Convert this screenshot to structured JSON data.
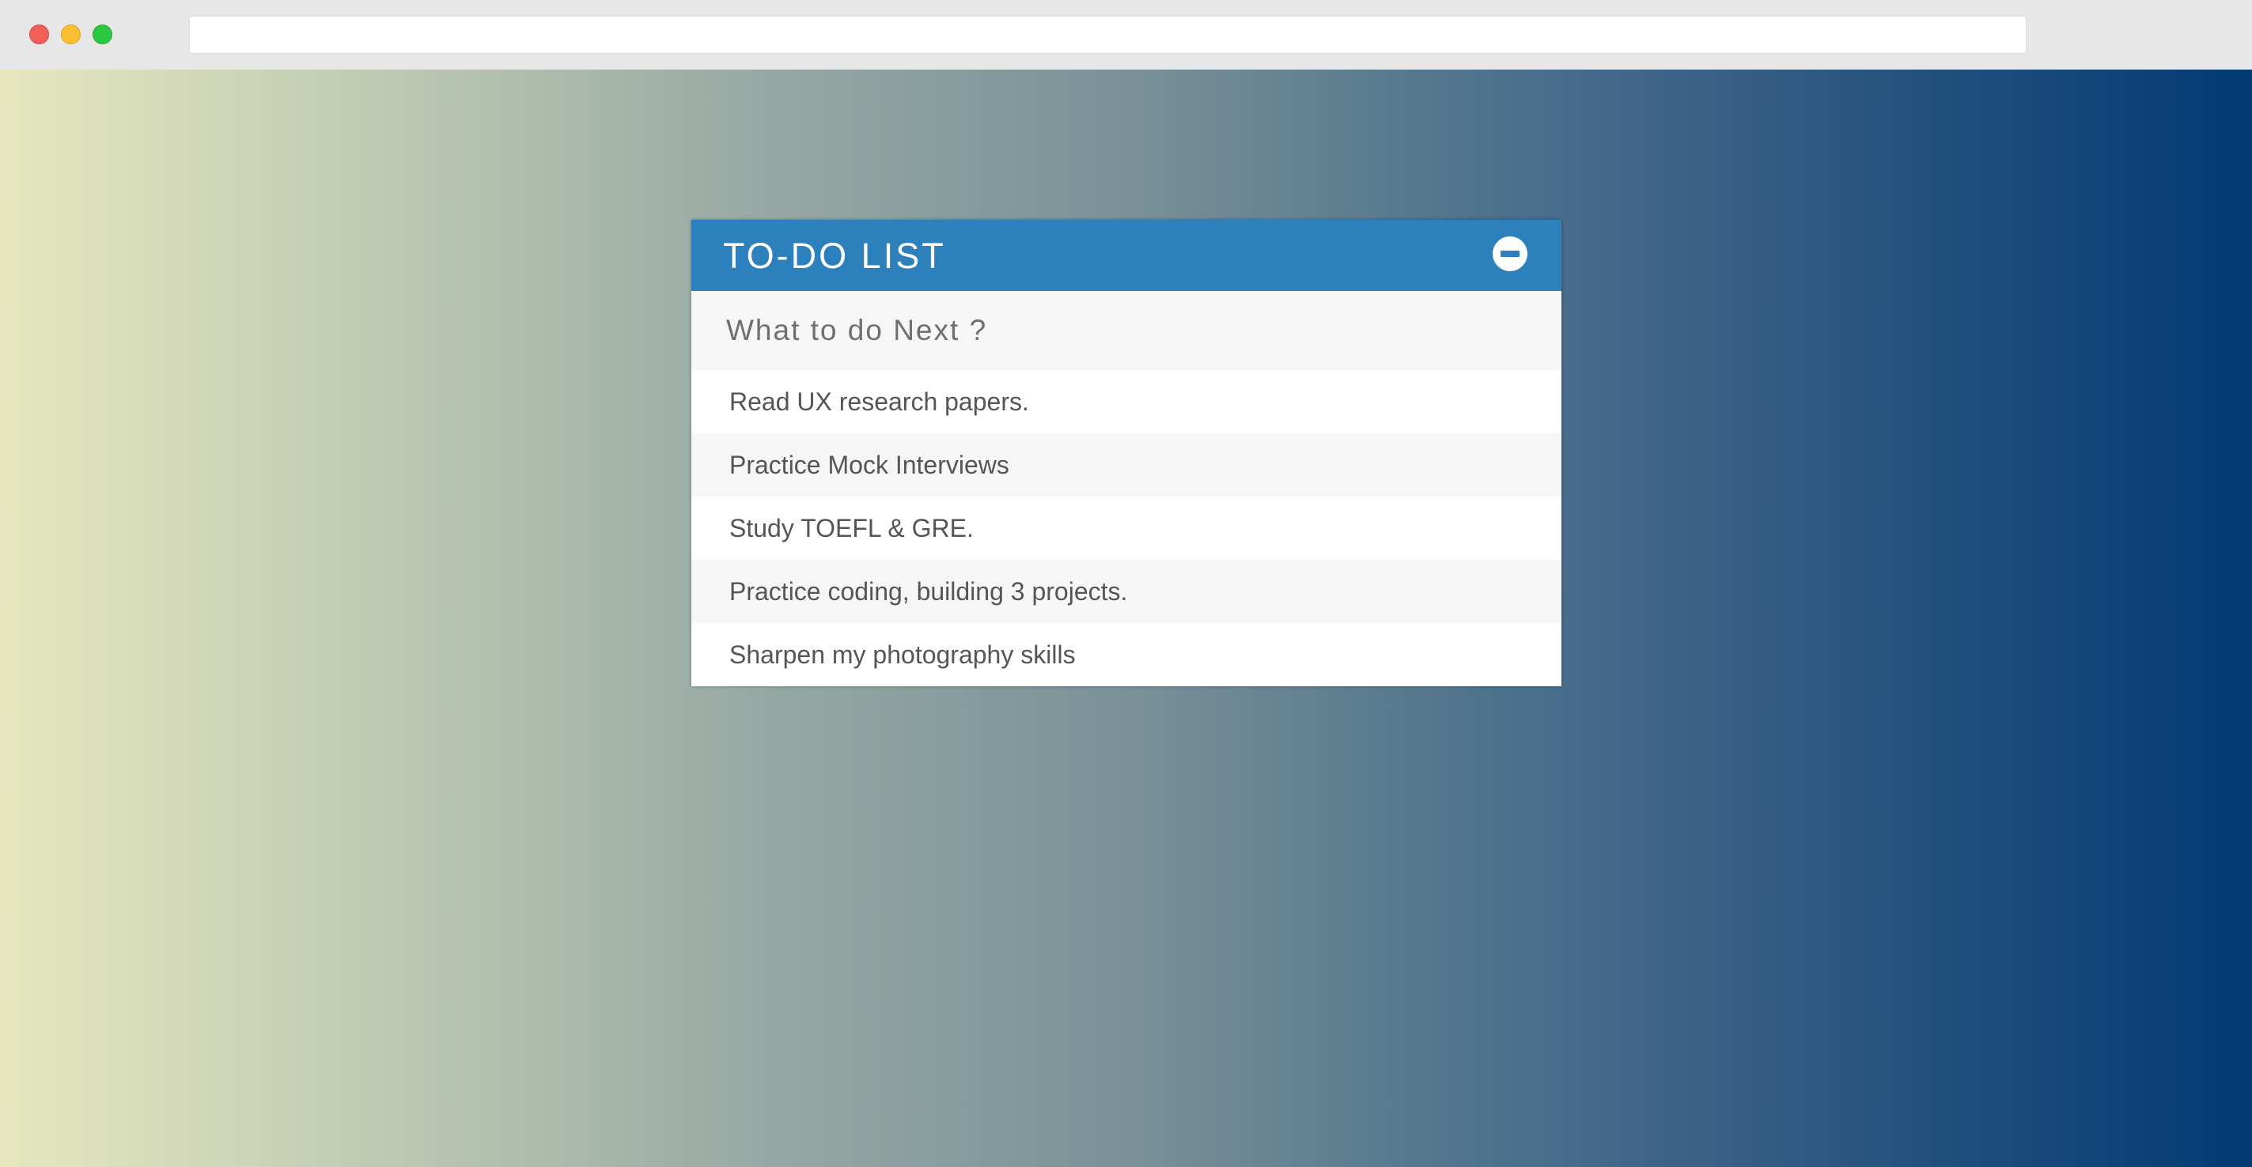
{
  "browser": {
    "address_value": ""
  },
  "colors": {
    "header": "#2c80bc",
    "gradient_start": "#e6e7bf",
    "gradient_end": "#033a73"
  },
  "todo": {
    "title": "TO-DO LIST",
    "toggle_icon": "minus-circle-icon",
    "input_placeholder": "What to do Next ?",
    "items": [
      "Read UX research papers.",
      "Practice Mock Interviews",
      "Study TOEFL & GRE.",
      "Practice coding, building 3 projects.",
      "Sharpen my photography skills"
    ]
  }
}
